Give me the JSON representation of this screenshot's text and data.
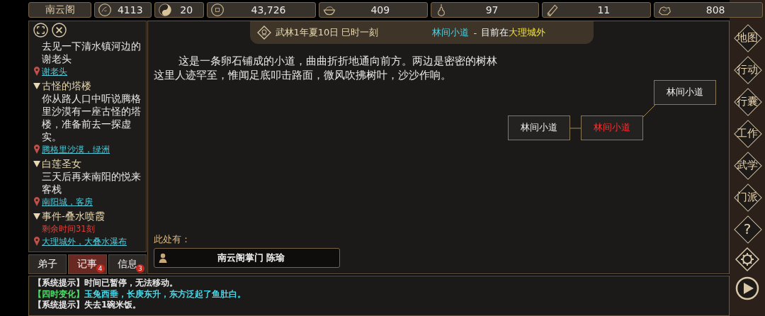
{
  "top_bar": {
    "sect_name": "南云阁",
    "stats": [
      {
        "kind": "flower",
        "value": "4113"
      },
      {
        "kind": "yinyang",
        "value": "20"
      },
      {
        "kind": "coin",
        "value": "43,726"
      },
      {
        "kind": "bowl",
        "value": "409"
      },
      {
        "kind": "gourd",
        "value": "97"
      },
      {
        "kind": "log",
        "value": "11"
      },
      {
        "kind": "ore",
        "value": "808"
      }
    ]
  },
  "quest_panel": {
    "quests": [
      {
        "description": "去见一下清水镇河边的谢老头",
        "location": "谢老头"
      },
      {
        "title": "古怪的塔楼",
        "expanded": true,
        "description": "你从路人口中听说腾格里沙漠有一座古怪的塔楼，准备前去一探虚实。",
        "location": "腾格里沙漠，绿洲"
      },
      {
        "title": "白莲圣女",
        "expanded": true,
        "description": "三天后再来南阳的悦来客栈",
        "location": "南阳城，客房"
      },
      {
        "title": "事件-叠水喷霞",
        "expanded": true,
        "timer": "剩余时间31刻",
        "location": "大理城外，大叠水瀑布"
      }
    ],
    "tabs": [
      {
        "label": "弟子",
        "selected": false
      },
      {
        "label": "记事",
        "selected": true,
        "badge": "4"
      },
      {
        "label": "信息",
        "selected": false,
        "badge": "3"
      }
    ]
  },
  "main": {
    "time": "武林1年夏10日 巳时一刻",
    "place": "林间小道",
    "separator": "-",
    "current_prefix": "目前在",
    "region": "大理城外",
    "description": "这是一条卵石铺成的小道，曲曲折折地通向前方。两边是密密的树林这里人迹罕至，惟闻足底叩击路面，微风吹拂树叶，沙沙作响。",
    "map_nodes": [
      {
        "label": "林间小道",
        "selected": false
      },
      {
        "label": "林间小道",
        "selected": true
      },
      {
        "label": "林间小道",
        "selected": false
      }
    ],
    "here_label": "此处有：",
    "npcs": [
      {
        "name": "南云阁掌门 陈瑜"
      }
    ]
  },
  "log": [
    {
      "kind": "system",
      "tag": "【系统提示】",
      "text": "时间已暂停，无法移动。"
    },
    {
      "kind": "season",
      "tag": "【四时变化】",
      "text": "玉兔西垂，长庚东升，东方泛起了鱼肚白。"
    },
    {
      "kind": "system",
      "tag": "【系统提示】",
      "text": "失去1碗米饭。"
    }
  ],
  "side_menu": [
    {
      "kind": "text",
      "label": "地图"
    },
    {
      "kind": "text",
      "label": "行动"
    },
    {
      "kind": "text",
      "label": "行囊"
    },
    {
      "kind": "text",
      "label": "工作"
    },
    {
      "kind": "text",
      "label": "武学"
    },
    {
      "kind": "text",
      "label": "门派"
    },
    {
      "kind": "text",
      "label": "?"
    },
    {
      "kind": "gear"
    },
    {
      "kind": "play"
    }
  ]
}
